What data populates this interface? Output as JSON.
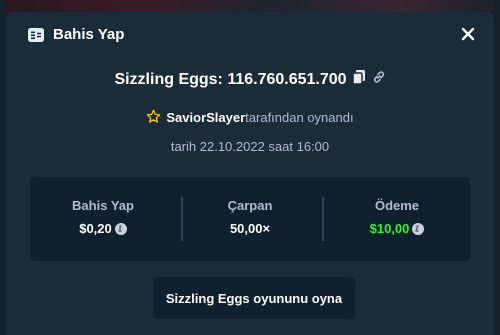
{
  "modal": {
    "title": "Bahis Yap",
    "icon": "bet-slip-icon",
    "close_icon": "close-icon"
  },
  "game": {
    "name_and_id": "Sizzling Eggs: 116.760.651.700",
    "copy_icon": "copy-icon",
    "link_icon": "link-icon"
  },
  "player": {
    "name": "SaviorSlayer",
    "suffix": "tarafından oynandı",
    "icon": "star-icon"
  },
  "date_text": "tarih 22.10.2022 saat 16:00",
  "stats": [
    {
      "label": "Bahis Yap",
      "value": "$0,20",
      "coin": true
    },
    {
      "label": "Çarpan",
      "value": "50,00×",
      "coin": false
    },
    {
      "label": "Ödeme",
      "value": "$10,00",
      "coin": true
    }
  ],
  "play_button_label": "Sizzling Eggs oyununu oyna",
  "colors": {
    "background": "#1a2c38",
    "panel": "#0f212e",
    "text_muted": "#b1bad3",
    "payout_green": "#1fff20",
    "star_yellow": "#ffd200"
  }
}
